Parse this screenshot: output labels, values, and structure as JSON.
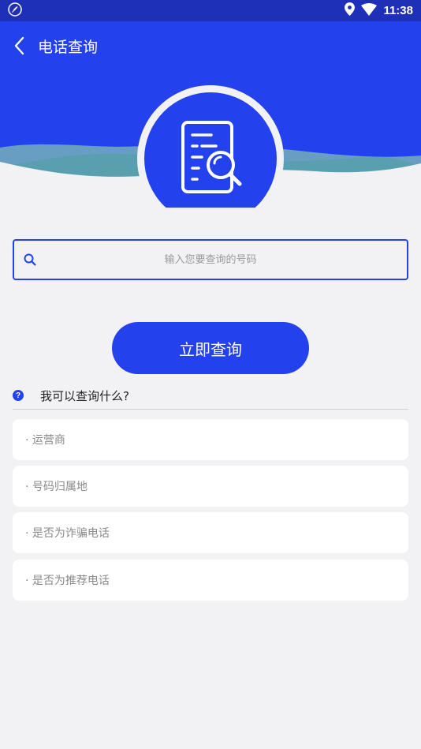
{
  "status_bar": {
    "time": "11:38",
    "icons": [
      "rocket-icon",
      "location-icon",
      "wifi-icon"
    ]
  },
  "app_bar": {
    "title": "电话查询",
    "back_icon": "chevron-left-icon"
  },
  "emblem": {
    "icon": "document-search-icon"
  },
  "search": {
    "placeholder": "输入您要查询的号码",
    "value": "",
    "icon": "search-icon"
  },
  "query_button": {
    "label": "立即查询"
  },
  "faq": {
    "icon": "help-icon",
    "icon_glyph": "?",
    "title": "我可以查询什么?",
    "items": [
      {
        "label": "· 运营商"
      },
      {
        "label": "· 号码归属地"
      },
      {
        "label": "· 是否为诈骗电话"
      },
      {
        "label": "· 是否为推荐电话"
      }
    ]
  },
  "colors": {
    "primary": "#2441ee",
    "status_bar": "#1e2fb8",
    "wave_teal": "#5a9fb0",
    "background": "#f2f2f4"
  }
}
